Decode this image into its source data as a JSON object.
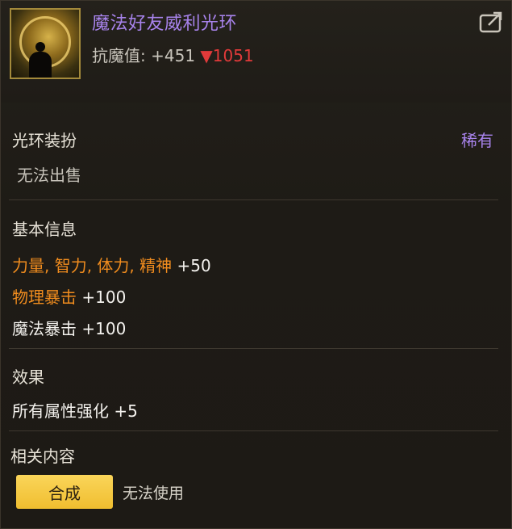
{
  "item": {
    "name": "魔法好友威利光环",
    "stat_label": "抗魔值:",
    "stat_value": "+451",
    "stat_change_arrow": "▼",
    "stat_change_value": "1051",
    "icon": "halo-figure-icon"
  },
  "header": {
    "share_icon": "share-export-icon"
  },
  "category": {
    "type": "光环装扮",
    "rarity": "稀有",
    "trade": "无法出售"
  },
  "basic_info": {
    "heading": "基本信息",
    "lines": [
      {
        "prefix": "力量, 智力, 体力, 精神 ",
        "value": "+50"
      },
      {
        "prefix": "物理暴击 ",
        "value": "+100"
      },
      {
        "prefix": "魔法暴击 ",
        "value": "+100"
      }
    ]
  },
  "effect": {
    "heading": "效果",
    "line": "所有属性强化 +5"
  },
  "related": {
    "heading": "相关内容",
    "compose_button": "合成",
    "usage_note": "无法使用"
  },
  "colors": {
    "rare_purple": "#a883ec",
    "stat_orange": "#f08c1e",
    "down_red": "#e23a3a",
    "button_yellow": "#f0be2f"
  }
}
